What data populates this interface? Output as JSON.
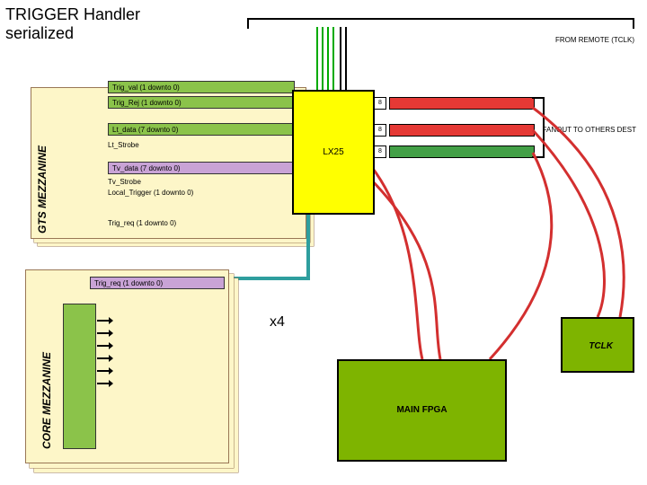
{
  "title_line1": "TRIGGER Handler",
  "title_line2": "serialized",
  "from_remote": "FROM REMOTE (TCLK)",
  "fanout": "FANOUT TO OTHERS DEST",
  "tclk_label": "TCLK",
  "gts_label": "GTS MEZZANINE",
  "core_label": "CORE MEZZANINE",
  "x4": "x4",
  "lx25": "LX25",
  "main_fpga": "MAIN FPGA",
  "eight_badge": "8",
  "signals": {
    "trig_val": "Trig_val (1 downto 0)",
    "trig_rej": "Trig_Rej (1 downto 0)",
    "lt_data": "Lt_data (7 downto 0)",
    "lt_strobe": "Lt_Strobe",
    "tv_data": "Tv_data (7 downto 0)",
    "tv_strobe": "Tv_Strobe",
    "local_trigger": "Local_Trigger (1 downto 0)",
    "trig_req_gts": "Trig_req (1 downto 0)",
    "trig_req_core": "Trig_req (1 downto 0)"
  }
}
